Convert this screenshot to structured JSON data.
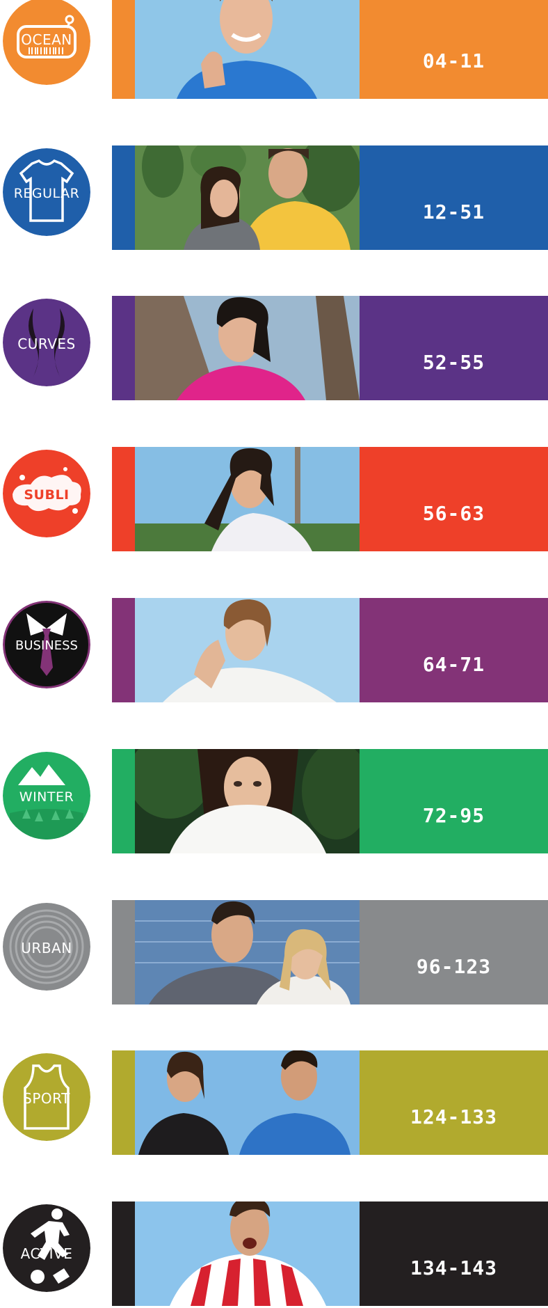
{
  "lines": [
    {
      "id": "ocean",
      "name": "OCEAN",
      "pages": "04-11",
      "color": "#F28B30",
      "photo_bg": "#8FC6E8"
    },
    {
      "id": "regular",
      "name": "REGULAR",
      "pages": "12-51",
      "color": "#1F5FAA",
      "photo_bg": "#5E8A4A"
    },
    {
      "id": "curves",
      "name": "CURVES",
      "pages": "52-55",
      "color": "#5B3386",
      "photo_bg": "#9CB8CF"
    },
    {
      "id": "subli",
      "name": "SUBLI",
      "pages": "56-63",
      "color": "#EE4029",
      "photo_bg": "#86BEE4"
    },
    {
      "id": "business",
      "name": "BUSINESS",
      "pages": "64-71",
      "color": "#833377",
      "photo_bg": "#A9D3EE"
    },
    {
      "id": "winter",
      "name": "WINTER",
      "pages": "72-95",
      "color": "#22AE62",
      "photo_bg": "#1E3A20"
    },
    {
      "id": "urban",
      "name": "URBAN",
      "pages": "96-123",
      "color": "#888A8C",
      "photo_bg": "#5E86B4"
    },
    {
      "id": "sport",
      "name": "SPORT",
      "pages": "124-133",
      "color": "#B1AA2E",
      "photo_bg": "#7FB9E6"
    },
    {
      "id": "active",
      "name": "ACTIVE",
      "pages": "134-143",
      "color": "#231F20",
      "photo_bg": "#8CC4EC"
    }
  ],
  "icons": [
    "price-tag-icon",
    "t-shirt-icon",
    "curves-silhouette-icon",
    "paint-splash-icon",
    "necktie-icon",
    "mountain-icon",
    "vinyl-record-icon",
    "tank-top-icon",
    "soccer-player-icon"
  ]
}
